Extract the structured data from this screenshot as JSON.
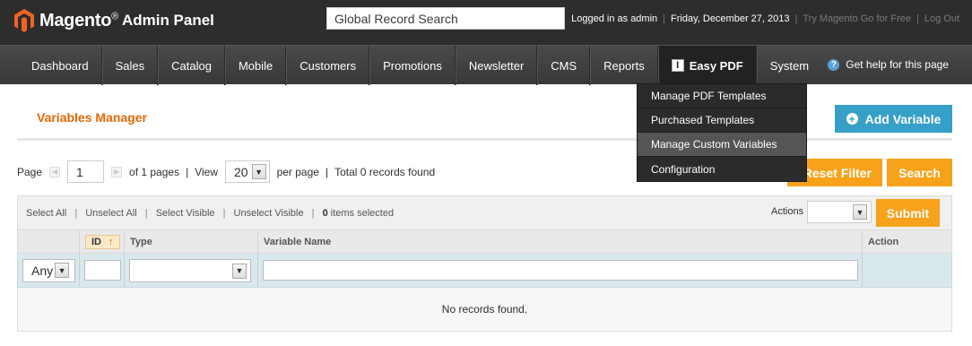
{
  "header": {
    "brand": "Magento",
    "brand_sup": "®",
    "brand_sub": "Admin Panel",
    "search_value": "Global Record Search",
    "logged_in": "Logged in as admin",
    "date": "Friday, December 27, 2013",
    "try_link": "Try Magento Go for Free",
    "logout": "Log Out"
  },
  "nav": {
    "items": [
      {
        "label": "Dashboard"
      },
      {
        "label": "Sales"
      },
      {
        "label": "Catalog"
      },
      {
        "label": "Mobile"
      },
      {
        "label": "Customers"
      },
      {
        "label": "Promotions"
      },
      {
        "label": "Newsletter"
      },
      {
        "label": "CMS"
      },
      {
        "label": "Reports"
      },
      {
        "label": "Easy PDF"
      },
      {
        "label": "System"
      }
    ],
    "help": "Get help for this page"
  },
  "dropdown": {
    "items": [
      {
        "label": "Manage PDF Templates"
      },
      {
        "label": "Purchased Templates"
      },
      {
        "label": "Manage Custom Variables"
      },
      {
        "label": "Configuration"
      }
    ]
  },
  "content": {
    "title": "Variables Manager",
    "add_button": "Add Variable",
    "reset_button": "Reset Filter",
    "search_button": "Search",
    "pager": {
      "page_label": "Page",
      "page_value": "1",
      "of_pages": "of 1 pages",
      "view_label": "View",
      "view_value": "20",
      "per_page": "per page",
      "total": "Total 0 records found"
    },
    "massaction": {
      "select_all": "Select All",
      "unselect_all": "Unselect All",
      "select_visible": "Select Visible",
      "unselect_visible": "Unselect Visible",
      "items_selected_count": "0",
      "items_selected_label": "items selected",
      "actions_label": "Actions",
      "submit": "Submit"
    },
    "grid": {
      "columns": [
        "",
        "ID",
        "Type",
        "Variable Name",
        "Action"
      ],
      "filter_any": "Any",
      "empty": "No records found."
    }
  },
  "colors": {
    "accent_orange": "#f7a21a",
    "title_orange": "#e26703",
    "add_blue": "#36a0c8",
    "header_dark": "#2d2d2d"
  }
}
